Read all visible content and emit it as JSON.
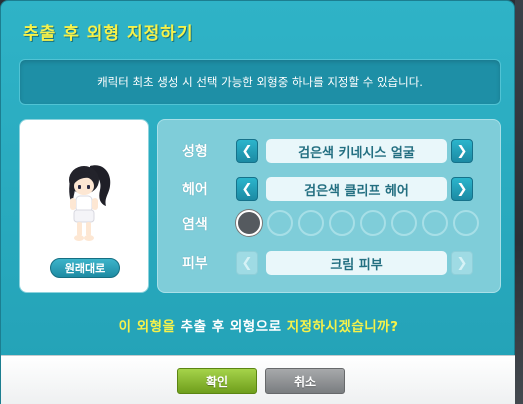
{
  "dialog": {
    "title": "추출 후 외형 지정하기",
    "notice": "캐릭터 최초 생성 시 선택 가능한 외형중 하나를 지정할 수 있습니다."
  },
  "preview": {
    "restore_label": "원래대로"
  },
  "options": {
    "face": {
      "label": "성형",
      "value": "검은색 키네시스 얼굴"
    },
    "hair": {
      "label": "헤어",
      "value": "검은색 클리프 헤어"
    },
    "dye": {
      "label": "염색",
      "selected_index": 0,
      "swatch_count": 8
    },
    "skin": {
      "label": "피부",
      "value": "크림 피부"
    }
  },
  "question": {
    "part1": "이 외형을",
    "part2": "추출 후 외형으로",
    "part3": "지정하시겠습니까?"
  },
  "footer": {
    "ok_label": "확인",
    "cancel_label": "취소"
  },
  "colors": {
    "title": "#f6f24a",
    "dialog_bg": "#2fb3c7",
    "ok_green": "#8bbd30",
    "cancel_gray": "#8e9093"
  }
}
